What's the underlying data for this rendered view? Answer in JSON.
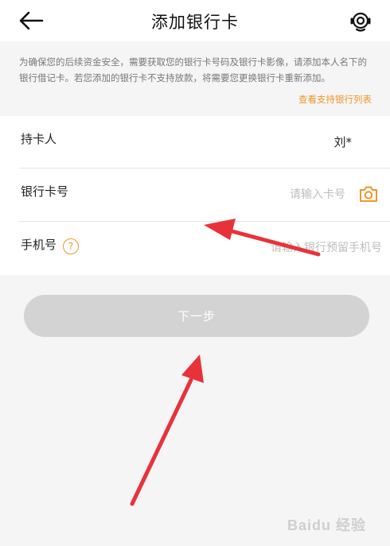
{
  "header": {
    "title": "添加银行卡",
    "back_icon": "arrow-left-icon",
    "service_icon": "customer-service-icon"
  },
  "notice": {
    "text": "为确保您的后续资金安全，需要获取您的银行卡号码及银行卡影像，请添加本人名下的银行借记卡。若您添加的银行卡不支持放款，将需要您更换银行卡重新添加。",
    "link": "查看支持银行列表"
  },
  "form": {
    "holder": {
      "label": "持卡人",
      "value": "刘*"
    },
    "card": {
      "label": "银行卡号",
      "placeholder": "请输入卡号",
      "icon": "camera-icon"
    },
    "phone": {
      "label": "手机号",
      "help_icon": "?",
      "placeholder": "请输入银行预留手机号"
    }
  },
  "next_button": "下一步",
  "watermark": "Baidu 经验",
  "colors": {
    "accent": "#f0962a",
    "button_disabled": "#d3d3d3",
    "annotation_arrow": "#e8323a",
    "background": "#f5f5f5"
  }
}
